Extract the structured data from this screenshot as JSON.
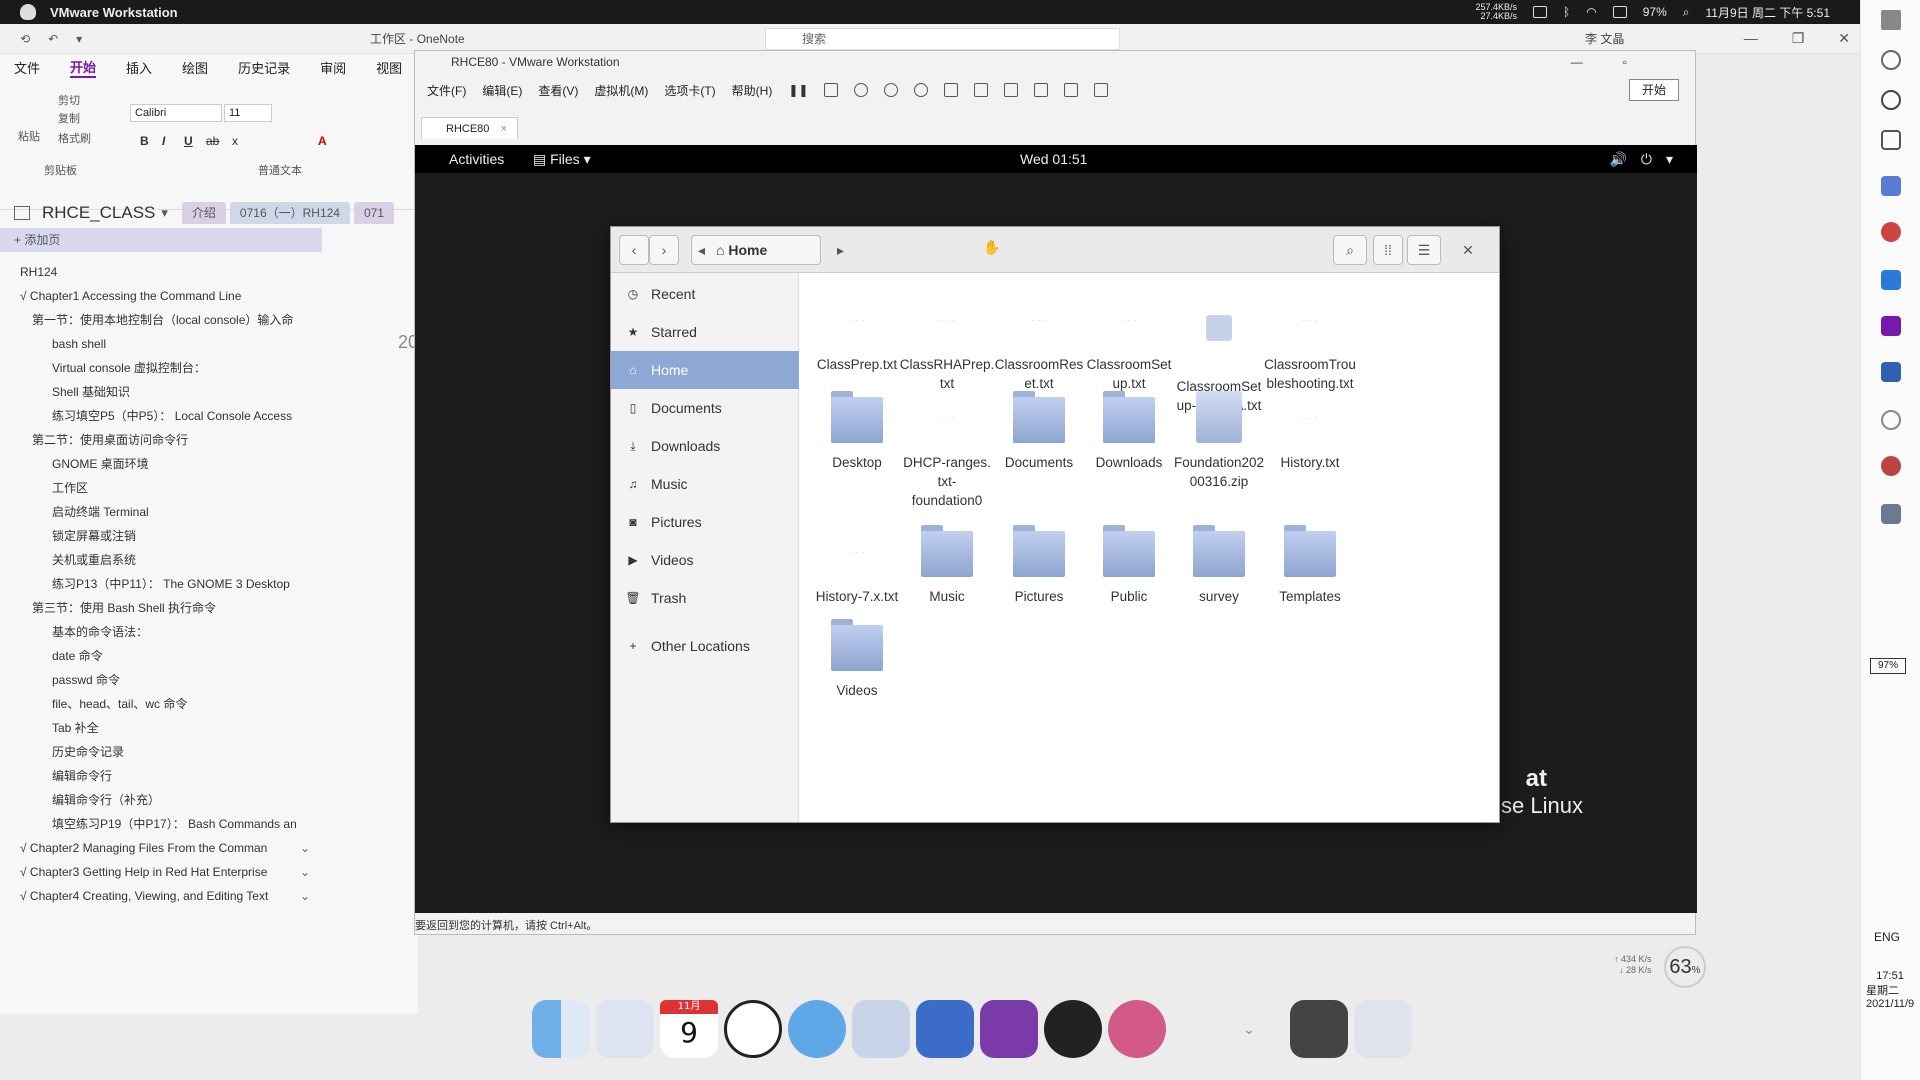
{
  "menubar": {
    "app_name": "VMware Workstation",
    "net_up": "257.4KB/s",
    "net_down": "27.4KB/s",
    "battery": "97%",
    "datetime": "11月9日 周二 下午 5:51"
  },
  "onenote": {
    "workspace": "工作区",
    "title_sep": "-",
    "app": "OneNote",
    "search_placeholder": "搜索",
    "user": "李 文晶",
    "tabs": [
      "文件",
      "开始",
      "插入",
      "绘图",
      "历史记录",
      "审阅",
      "视图"
    ],
    "ribbon": {
      "paste": "粘贴",
      "cut": "剪切",
      "copy": "复制",
      "format_painter": "格式刷",
      "clipboard_group": "剪贴板",
      "font": "Calibri",
      "size": "11",
      "text_group": "普通文本",
      "bold": "B",
      "italic": "I",
      "underline": "U",
      "strike": "ab",
      "subscript": "x",
      "font_color": "A"
    },
    "notebook": "RHCE_CLASS",
    "sections": [
      "介绍",
      "0716（一）RH124",
      "071"
    ],
    "add_page": "添加页",
    "pages": [
      {
        "text": "RH124",
        "level": "l0"
      },
      {
        "text": "√ Chapter1 Accessing the Command Line",
        "level": "l0"
      },
      {
        "text": "第一节：使用本地控制台（local console）输入命",
        "level": "l1"
      },
      {
        "text": "bash shell",
        "level": "l3"
      },
      {
        "text": "Virtual console 虚拟控制台：",
        "level": "l3"
      },
      {
        "text": "Shell 基础知识",
        "level": "l3"
      },
      {
        "text": "练习填空P5（中P5）： Local Console Access",
        "level": "l3"
      },
      {
        "text": "第二节：使用桌面访问命令行",
        "level": "l1"
      },
      {
        "text": "GNOME 桌面环境",
        "level": "l3"
      },
      {
        "text": "工作区",
        "level": "l3"
      },
      {
        "text": "启动终端 Terminal",
        "level": "l3"
      },
      {
        "text": "锁定屏幕或注销",
        "level": "l3"
      },
      {
        "text": "关机或重启系统",
        "level": "l3"
      },
      {
        "text": "练习P13（中P11）： The GNOME 3 Desktop",
        "level": "l3"
      },
      {
        "text": "第三节：使用 Bash Shell 执行命令",
        "level": "l1"
      },
      {
        "text": "基本的命令语法：",
        "level": "l3"
      },
      {
        "text": "date 命令",
        "level": "l3"
      },
      {
        "text": "passwd 命令",
        "level": "l3"
      },
      {
        "text": "file、head、tail、wc 命令",
        "level": "l3"
      },
      {
        "text": "Tab 补全",
        "level": "l3"
      },
      {
        "text": "历史命令记录",
        "level": "l3"
      },
      {
        "text": "编辑命令行",
        "level": "l3"
      },
      {
        "text": "编辑命令行（补充）",
        "level": "l3"
      },
      {
        "text": "填空练习P19（中P17）： Bash Commands an",
        "level": "l3"
      }
    ],
    "chapters": [
      "√ Chapter2 Managing Files From the Comman",
      "√ Chapter3 Getting Help in Red Hat Enterprise",
      "√ Chapter4 Creating, Viewing, and Editing Text"
    ],
    "page_fragment": "20"
  },
  "vmware": {
    "title": "RHCE80 - VMware Workstation",
    "menu": [
      "文件(F)",
      "编辑(E)",
      "查看(V)",
      "虚拟机(M)",
      "选项卡(T)",
      "帮助(H)"
    ],
    "start_button": "开始",
    "tab": "RHCE80",
    "status": "要返回到您的计算机，请按 Ctrl+Alt。"
  },
  "gnome": {
    "activities": "Activities",
    "files_menu": "Files",
    "clock": "Wed 01:51",
    "rhel_brand": "Enterprise Linux",
    "rhel_frag": "at"
  },
  "nautilus": {
    "path": "Home",
    "sidebar": [
      {
        "label": "Recent",
        "icon": "clock-icon"
      },
      {
        "label": "Starred",
        "icon": "star-icon"
      },
      {
        "label": "Home",
        "icon": "home-icon"
      },
      {
        "label": "Documents",
        "icon": "document-icon"
      },
      {
        "label": "Downloads",
        "icon": "download-icon"
      },
      {
        "label": "Music",
        "icon": "music-icon"
      },
      {
        "label": "Pictures",
        "icon": "camera-icon"
      },
      {
        "label": "Videos",
        "icon": "video-icon"
      },
      {
        "label": "Trash",
        "icon": "trash-icon"
      },
      {
        "label": "Other Locations",
        "icon": "plus-icon"
      }
    ],
    "files": [
      {
        "name": "ClassPrep.txt",
        "kind": "txt"
      },
      {
        "name": "ClassRHAPrep.\ntxt",
        "kind": "txt"
      },
      {
        "name": "ClassroomRes\net.txt",
        "kind": "txt"
      },
      {
        "name": "ClassroomSet\nup.txt",
        "kind": "txt"
      },
      {
        "name": "ClassroomSet\nup-RHCSA.txt",
        "kind": "sfile"
      },
      {
        "name": "ClassroomTrou\nbleshooting.txt",
        "kind": "txt"
      },
      {
        "name": "Desktop",
        "kind": "folder"
      },
      {
        "name": "DHCP-ranges.\ntxt-\nfoundation0",
        "kind": "txt"
      },
      {
        "name": "Documents",
        "kind": "folder"
      },
      {
        "name": "Downloads",
        "kind": "folder"
      },
      {
        "name": "Foundation202\n00316.zip",
        "kind": "zip"
      },
      {
        "name": "History.txt",
        "kind": "txt"
      },
      {
        "name": "History-7.x.txt",
        "kind": "txt"
      },
      {
        "name": "Music",
        "kind": "folder"
      },
      {
        "name": "Pictures",
        "kind": "folder"
      },
      {
        "name": "Public",
        "kind": "folder"
      },
      {
        "name": "survey",
        "kind": "folder"
      },
      {
        "name": "Templates",
        "kind": "folder"
      },
      {
        "name": "Videos",
        "kind": "folder"
      }
    ]
  },
  "taskbar": {
    "battery": "97%",
    "lang": "ENG",
    "time": "17:51",
    "day": "星期二",
    "date": "2021/11/9",
    "net_up": "↑ 434 K/s",
    "net_down": "↓ 28 K/s",
    "cpu_gauge": "63",
    "cpu_unit": "%"
  },
  "dock": {
    "calendar_month": "11月",
    "calendar_day": "9"
  }
}
